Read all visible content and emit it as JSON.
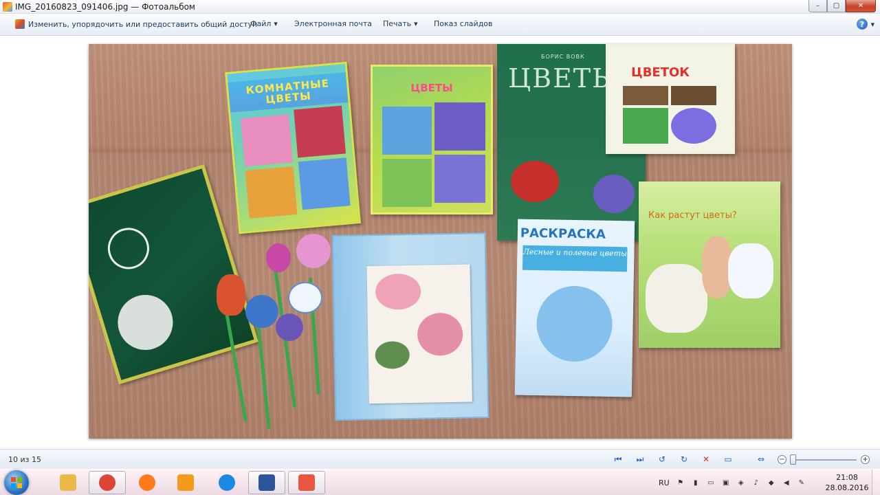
{
  "window": {
    "title": "IMG_20160823_091406.jpg — Фотоальбом",
    "minimize_glyph": "–",
    "maximize_glyph": "▢",
    "close_glyph": "✕"
  },
  "commandbar": {
    "items": [
      {
        "label": "Изменить, упорядочить или предоставить общий доступ",
        "has_caret": false
      },
      {
        "label": "Файл",
        "has_caret": true
      },
      {
        "label": "Электронная почта",
        "has_caret": false
      },
      {
        "label": "Печать",
        "has_caret": true
      },
      {
        "label": "Показ слайдов",
        "has_caret": false
      }
    ],
    "caret_glyph": "▼",
    "help_glyph": "?"
  },
  "photo": {
    "book_komnatnye_title": "КОМНАТНЫЕ ЦВЕТЫ",
    "book_tsvety_title": "ЦВЕТЫ",
    "book_vovk_author": "БОРИС ВОВК",
    "book_vovk_title": "ЦВЕТЫ",
    "book_tsvetok_title": "ЦВЕТОК",
    "book_raskraska_title": "РАСКРАСКА",
    "book_raskraska_subtitle": "Лесные и полевые цветы",
    "book_kak_rastut_title": "Как растут цветы?"
  },
  "statusbar": {
    "counter": "10 из 15",
    "controls": {
      "previous": "⏮",
      "next": "⏭",
      "rotate_left": "↺",
      "rotate_right": "↻",
      "delete": "✕",
      "slideshow": "▭",
      "fit": "⇔",
      "zoom_out": "−",
      "zoom_in": "+"
    },
    "zoom_level": 0.03
  },
  "taskbar": {
    "apps": [
      {
        "name": "explorer",
        "color": "#e9b949"
      },
      {
        "name": "chrome",
        "color": "#db4437"
      },
      {
        "name": "firefox",
        "color": "#ff7a1a"
      },
      {
        "name": "media-player",
        "color": "#f29b1d"
      },
      {
        "name": "internet-explorer",
        "color": "#1e88e5"
      },
      {
        "name": "word",
        "color": "#2b579a"
      },
      {
        "name": "photo-gallery",
        "color": "#e8563f"
      }
    ],
    "language": "RU",
    "time": "21:08",
    "date": "28.08.2016"
  }
}
